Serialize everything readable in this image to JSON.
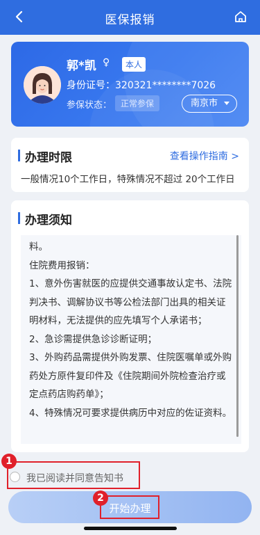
{
  "header": {
    "title": "医保报销"
  },
  "profile": {
    "name": "郭*凯",
    "gender_symbol": "♀",
    "self_tag": "本人",
    "id_label": "身份证号：",
    "id_value": "320321********7026",
    "status_label": "参保状态：",
    "status_value": "正常参保",
    "city": "南京市"
  },
  "handling_time": {
    "title": "办理时限",
    "guide_link": "查看操作指南 >",
    "description": "一般情况10个工作日，特殊情况不超过 20个工作日"
  },
  "notice": {
    "title": "办理须知",
    "lines": [
      "料。",
      "住院费用报销：",
      "1、意外伤害就医的应提供交通事故认定书、法院判决书、调解协议书等公检法部门出具的相关证明材料，无法提供的应先填写个人承诺书；",
      "2、急诊需提供急诊诊断证明；",
      "3、外购药品需提供外购发票、住院医嘱单或外购药处方原件复印件及《住院期间外院检查治疗或定点药店购药单》；",
      "4、特殊情况可要求提供病历中对应的佐证资料。"
    ]
  },
  "agreement": {
    "label": "我已阅读并同意告知书"
  },
  "actions": {
    "start_label": "开始办理"
  },
  "annotations": {
    "one": "1",
    "two": "2"
  },
  "colors": {
    "primary": "#2f6de0",
    "annotation": "#e0202a"
  }
}
